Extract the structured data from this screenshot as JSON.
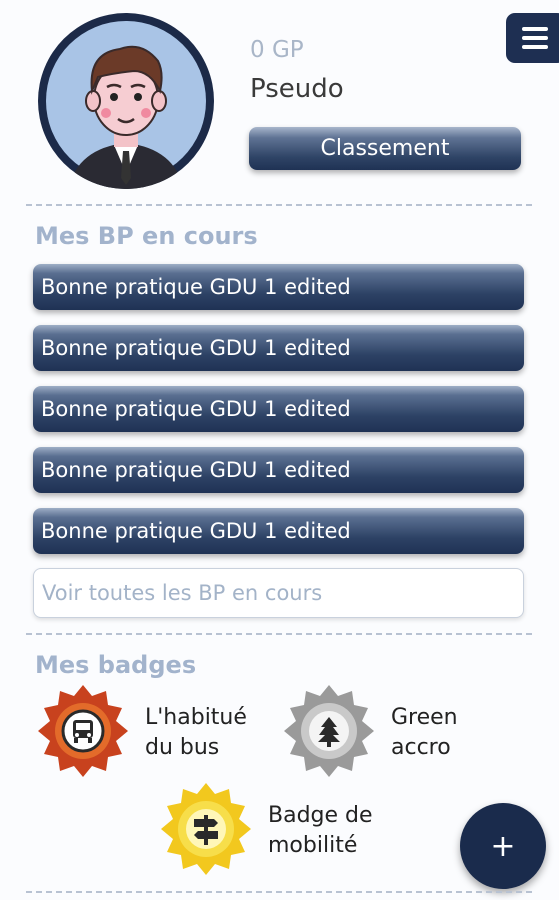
{
  "profile": {
    "points": "0 GP",
    "pseudo": "Pseudo",
    "ranking_button": "Classement"
  },
  "menu": {
    "icon": "hamburger-menu-icon"
  },
  "bp_section": {
    "title": "Mes BP en cours",
    "items": [
      {
        "label": "Bonne pratique GDU 1 edited"
      },
      {
        "label": "Bonne pratique GDU 1 edited"
      },
      {
        "label": "Bonne pratique GDU 1 edited"
      },
      {
        "label": "Bonne pratique GDU 1 edited"
      },
      {
        "label": "Bonne pratique GDU 1 edited"
      }
    ],
    "see_all": "Voir toutes les BP en cours"
  },
  "badges_section": {
    "title": "Mes badges",
    "badges": [
      {
        "line1": "L'habitué",
        "line2": "du bus",
        "icon": "bus-icon",
        "color": "#c8421e"
      },
      {
        "line1": "Green",
        "line2": "accro",
        "icon": "tree-icon",
        "color": "#8a8a8a"
      },
      {
        "line1": "Badge de",
        "line2": "mobilité",
        "icon": "signpost-icon",
        "color": "#f2c81e"
      }
    ]
  },
  "fab": {
    "label": "+"
  },
  "colors": {
    "navy": "#1e2f52",
    "accent_light": "#a2b3cc"
  }
}
